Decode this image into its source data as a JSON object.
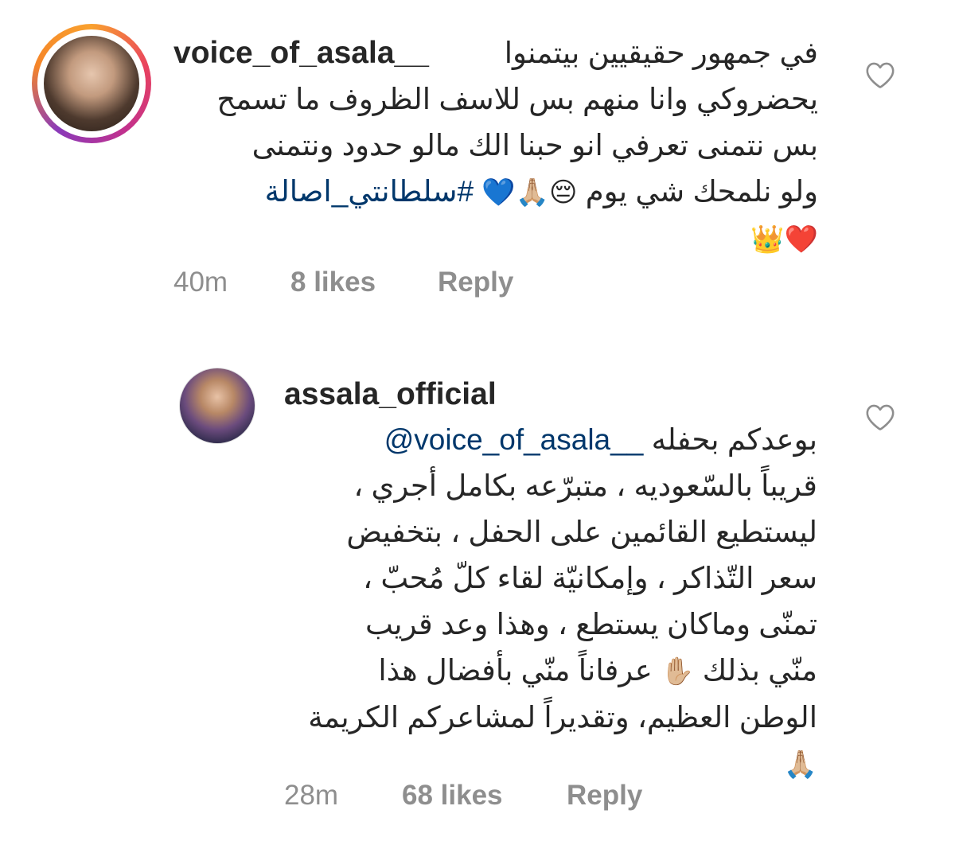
{
  "comments": [
    {
      "username": "voice_of_asala__",
      "lines": [
        "في جمهور حقيقيين بيتمنوا",
        "يحضروكي وانا منهم بس للاسف الظروف ما تسمح",
        "بس نتمنى تعرفي انو حبنا الك مالو حدود ونتمنى",
        "ولو نلمحك شي يوم"
      ],
      "line4_emojis": "😔🙏🏼💙",
      "hashtag": "#سلطانتي_اصالة",
      "line5_emojis": "❤️👑",
      "time": "40m",
      "likes": "8 likes",
      "reply": "Reply",
      "avatar_icon": "profile-photo-woman",
      "story_ring": true
    },
    {
      "username": "assala_official",
      "mention": "@voice_of_asala__",
      "first_text": "بوعدكم بحفله",
      "lines": [
        "قريباً بالسّعوديه ، متبرّعه بكامل أجري ،",
        "ليستطيع القائمين على الحفل ، بتخفيض",
        "سعر التّذاكر ، وإمكانيّة لقاء كلّ مُحبّ ،",
        "تمنّى وماكان يستطع ، وهذا وعد قريب",
        "عرفاناً منّي بأفضال هذا",
        "الوطن العظيم، وتقديراً لمشاعركم الكريمة"
      ],
      "line6_prefix": "منّي بذلك",
      "hand_emoji": "✋🏼",
      "pray_emoji": "🙏🏼",
      "time": "28m",
      "likes": "68 likes",
      "reply": "Reply",
      "avatar_icon": "profile-photo-woman"
    }
  ],
  "colors": {
    "text": "#262626",
    "muted": "#8e8e8e",
    "link": "#00376b"
  }
}
